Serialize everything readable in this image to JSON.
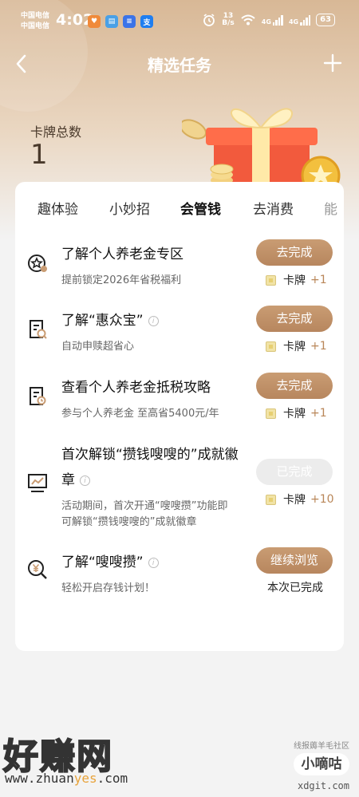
{
  "status_bar": {
    "carrier_1": "中国电信",
    "carrier_2": "中国电信",
    "time": "4:02",
    "speed_value": "13",
    "speed_unit": "B/s",
    "net_1": "4G",
    "net_2": "4G",
    "battery": "63"
  },
  "header": {
    "title": "精选任务"
  },
  "summary": {
    "label": "卡牌总数",
    "value": "1"
  },
  "tabs": [
    {
      "label": "趣体验"
    },
    {
      "label": "小妙招"
    },
    {
      "label": "会管钱",
      "active": true
    },
    {
      "label": "去消费"
    },
    {
      "label": "能"
    }
  ],
  "tasks": [
    {
      "title": "了解个人养老金专区",
      "subtitle": "提前锁定2026年省税福利",
      "button": "去完成",
      "reward_name": "卡牌",
      "reward_value": "+1",
      "icon": "star-gear-icon"
    },
    {
      "title": "了解“惠众宝”",
      "subtitle": "自动申赎超省心",
      "button": "去完成",
      "reward_name": "卡牌",
      "reward_value": "+1",
      "icon": "doc-search-icon"
    },
    {
      "title": "查看个人养老金抵税攻略",
      "subtitle": "参与个人养老金 至高省5400元/年",
      "button": "去完成",
      "reward_name": "卡牌",
      "reward_value": "+1",
      "icon": "doc-clock-icon"
    },
    {
      "title_line1": "首次解锁“攒钱嗖嗖的”成就徽",
      "title_line2": "章",
      "subtitle_line1": "活动期间，首次开通“嗖嗖攒”功能即",
      "subtitle_line2": "可解锁“攒钱嗖嗖的”成就徽章",
      "button": "已完成",
      "reward_name": "卡牌",
      "reward_value": "+10",
      "icon": "chart-board-icon"
    },
    {
      "title": "了解“嗖嗖攒”",
      "subtitle": "轻松开启存钱计划！",
      "button": "继续浏览",
      "status": "本次已完成",
      "icon": "yen-search-icon"
    }
  ],
  "watermark": {
    "left_text": "好赚网",
    "url_prefix": "www.zhuan",
    "url_highlight": "yes",
    "url_suffix": ".com",
    "right_small": "线报薅羊毛社区",
    "right_badge": "小嘀咕",
    "right_url": "xdgit.com"
  },
  "colors": {
    "accent_button": "#b7865e",
    "reward_plus": "#b98658",
    "hero_top": "#d8b896"
  }
}
